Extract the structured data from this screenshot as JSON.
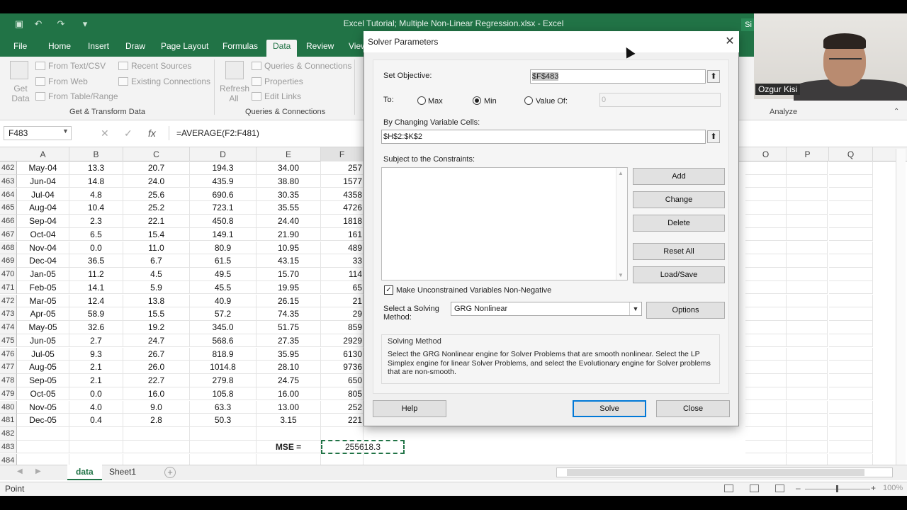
{
  "window": {
    "title": "Excel Tutorial; Multiple Non-Linear Regression.xlsx  -  Excel",
    "signin": "Si"
  },
  "ribbon": {
    "tabs": [
      "File",
      "Home",
      "Insert",
      "Draw",
      "Page Layout",
      "Formulas",
      "Data",
      "Review",
      "View"
    ],
    "active_tab": "Data",
    "get_data_label": "Get Data",
    "from_text": "From Text/CSV",
    "from_web": "From Web",
    "from_table": "From Table/Range",
    "recent_sources": "Recent Sources",
    "existing_connections": "Existing Connections",
    "refresh_all_label": "Refresh All",
    "queries_connections": "Queries & Connections",
    "properties": "Properties",
    "edit_links": "Edit Links",
    "group_get_transform": "Get & Transform Data",
    "group_queries": "Queries & Connections",
    "group_analyze": "Analyze"
  },
  "formula_bar": {
    "name_box": "F483",
    "formula": "=AVERAGE(F2:F481)"
  },
  "columns": [
    "A",
    "B",
    "C",
    "D",
    "E",
    "F",
    "O",
    "P",
    "Q"
  ],
  "rows": [
    {
      "n": "462",
      "a": "May-04",
      "b": "13.3",
      "c": "20.7",
      "d": "194.3",
      "e": "34.00",
      "f": "257"
    },
    {
      "n": "463",
      "a": "Jun-04",
      "b": "14.8",
      "c": "24.0",
      "d": "435.9",
      "e": "38.80",
      "f": "1577"
    },
    {
      "n": "464",
      "a": "Jul-04",
      "b": "4.8",
      "c": "25.6",
      "d": "690.6",
      "e": "30.35",
      "f": "4358"
    },
    {
      "n": "465",
      "a": "Aug-04",
      "b": "10.4",
      "c": "25.2",
      "d": "723.1",
      "e": "35.55",
      "f": "4726"
    },
    {
      "n": "466",
      "a": "Sep-04",
      "b": "2.3",
      "c": "22.1",
      "d": "450.8",
      "e": "24.40",
      "f": "1818"
    },
    {
      "n": "467",
      "a": "Oct-04",
      "b": "6.5",
      "c": "15.4",
      "d": "149.1",
      "e": "21.90",
      "f": "161"
    },
    {
      "n": "468",
      "a": "Nov-04",
      "b": "0.0",
      "c": "11.0",
      "d": "80.9",
      "e": "10.95",
      "f": "489"
    },
    {
      "n": "469",
      "a": "Dec-04",
      "b": "36.5",
      "c": "6.7",
      "d": "61.5",
      "e": "43.15",
      "f": "33"
    },
    {
      "n": "470",
      "a": "Jan-05",
      "b": "11.2",
      "c": "4.5",
      "d": "49.5",
      "e": "15.70",
      "f": "114"
    },
    {
      "n": "471",
      "a": "Feb-05",
      "b": "14.1",
      "c": "5.9",
      "d": "45.5",
      "e": "19.95",
      "f": "65"
    },
    {
      "n": "472",
      "a": "Mar-05",
      "b": "12.4",
      "c": "13.8",
      "d": "40.9",
      "e": "26.15",
      "f": "21"
    },
    {
      "n": "473",
      "a": "Apr-05",
      "b": "58.9",
      "c": "15.5",
      "d": "57.2",
      "e": "74.35",
      "f": "29"
    },
    {
      "n": "474",
      "a": "May-05",
      "b": "32.6",
      "c": "19.2",
      "d": "345.0",
      "e": "51.75",
      "f": "859"
    },
    {
      "n": "475",
      "a": "Jun-05",
      "b": "2.7",
      "c": "24.7",
      "d": "568.6",
      "e": "27.35",
      "f": "2929"
    },
    {
      "n": "476",
      "a": "Jul-05",
      "b": "9.3",
      "c": "26.7",
      "d": "818.9",
      "e": "35.95",
      "f": "6130"
    },
    {
      "n": "477",
      "a": "Aug-05",
      "b": "2.1",
      "c": "26.0",
      "d": "1014.8",
      "e": "28.10",
      "f": "9736"
    },
    {
      "n": "478",
      "a": "Sep-05",
      "b": "2.1",
      "c": "22.7",
      "d": "279.8",
      "e": "24.75",
      "f": "650"
    },
    {
      "n": "479",
      "a": "Oct-05",
      "b": "0.0",
      "c": "16.0",
      "d": "105.8",
      "e": "16.00",
      "f": "805"
    },
    {
      "n": "480",
      "a": "Nov-05",
      "b": "4.0",
      "c": "9.0",
      "d": "63.3",
      "e": "13.00",
      "f": "252"
    },
    {
      "n": "481",
      "a": "Dec-05",
      "b": "0.4",
      "c": "2.8",
      "d": "50.3",
      "e": "3.15",
      "f": "221"
    },
    {
      "n": "482",
      "a": "",
      "b": "",
      "c": "",
      "d": "",
      "e": "",
      "f": ""
    },
    {
      "n": "483",
      "a": "",
      "b": "",
      "c": "",
      "d": "",
      "e": "",
      "f": ""
    },
    {
      "n": "484",
      "a": "",
      "b": "",
      "c": "",
      "d": "",
      "e": "",
      "f": ""
    }
  ],
  "mse": {
    "label": "MSE =",
    "value": "255618.3"
  },
  "sheets": [
    "data",
    "Sheet1"
  ],
  "active_sheet": "data",
  "status": {
    "mode": "Point",
    "zoom": "100%"
  },
  "webcam": {
    "name": "Ozgur Kisi"
  },
  "solver": {
    "title": "Solver Parameters",
    "set_objective_label": "Set Objective:",
    "objective_value": "$F$483",
    "to_label": "To:",
    "opt_max": "Max",
    "opt_min": "Min",
    "opt_value_of": "Value Of:",
    "value_of_value": "0",
    "selected_option": "Min",
    "changing_label": "By Changing Variable Cells:",
    "changing_value": "$H$2:$K$2",
    "constraints_label": "Subject to the Constraints:",
    "btn_add": "Add",
    "btn_change": "Change",
    "btn_delete": "Delete",
    "btn_reset": "Reset All",
    "btn_load": "Load/Save",
    "nonneg_label": "Make Unconstrained Variables Non-Negative",
    "nonneg_checked": true,
    "method_label": "Select a Solving Method:",
    "method_value": "GRG Nonlinear",
    "btn_options": "Options",
    "method_title": "Solving Method",
    "method_text": "Select the GRG Nonlinear engine for Solver Problems that are smooth nonlinear. Select the LP Simplex engine for linear Solver Problems, and select the Evolutionary engine for Solver problems that are non-smooth.",
    "btn_help": "Help",
    "btn_solve": "Solve",
    "btn_close": "Close"
  }
}
